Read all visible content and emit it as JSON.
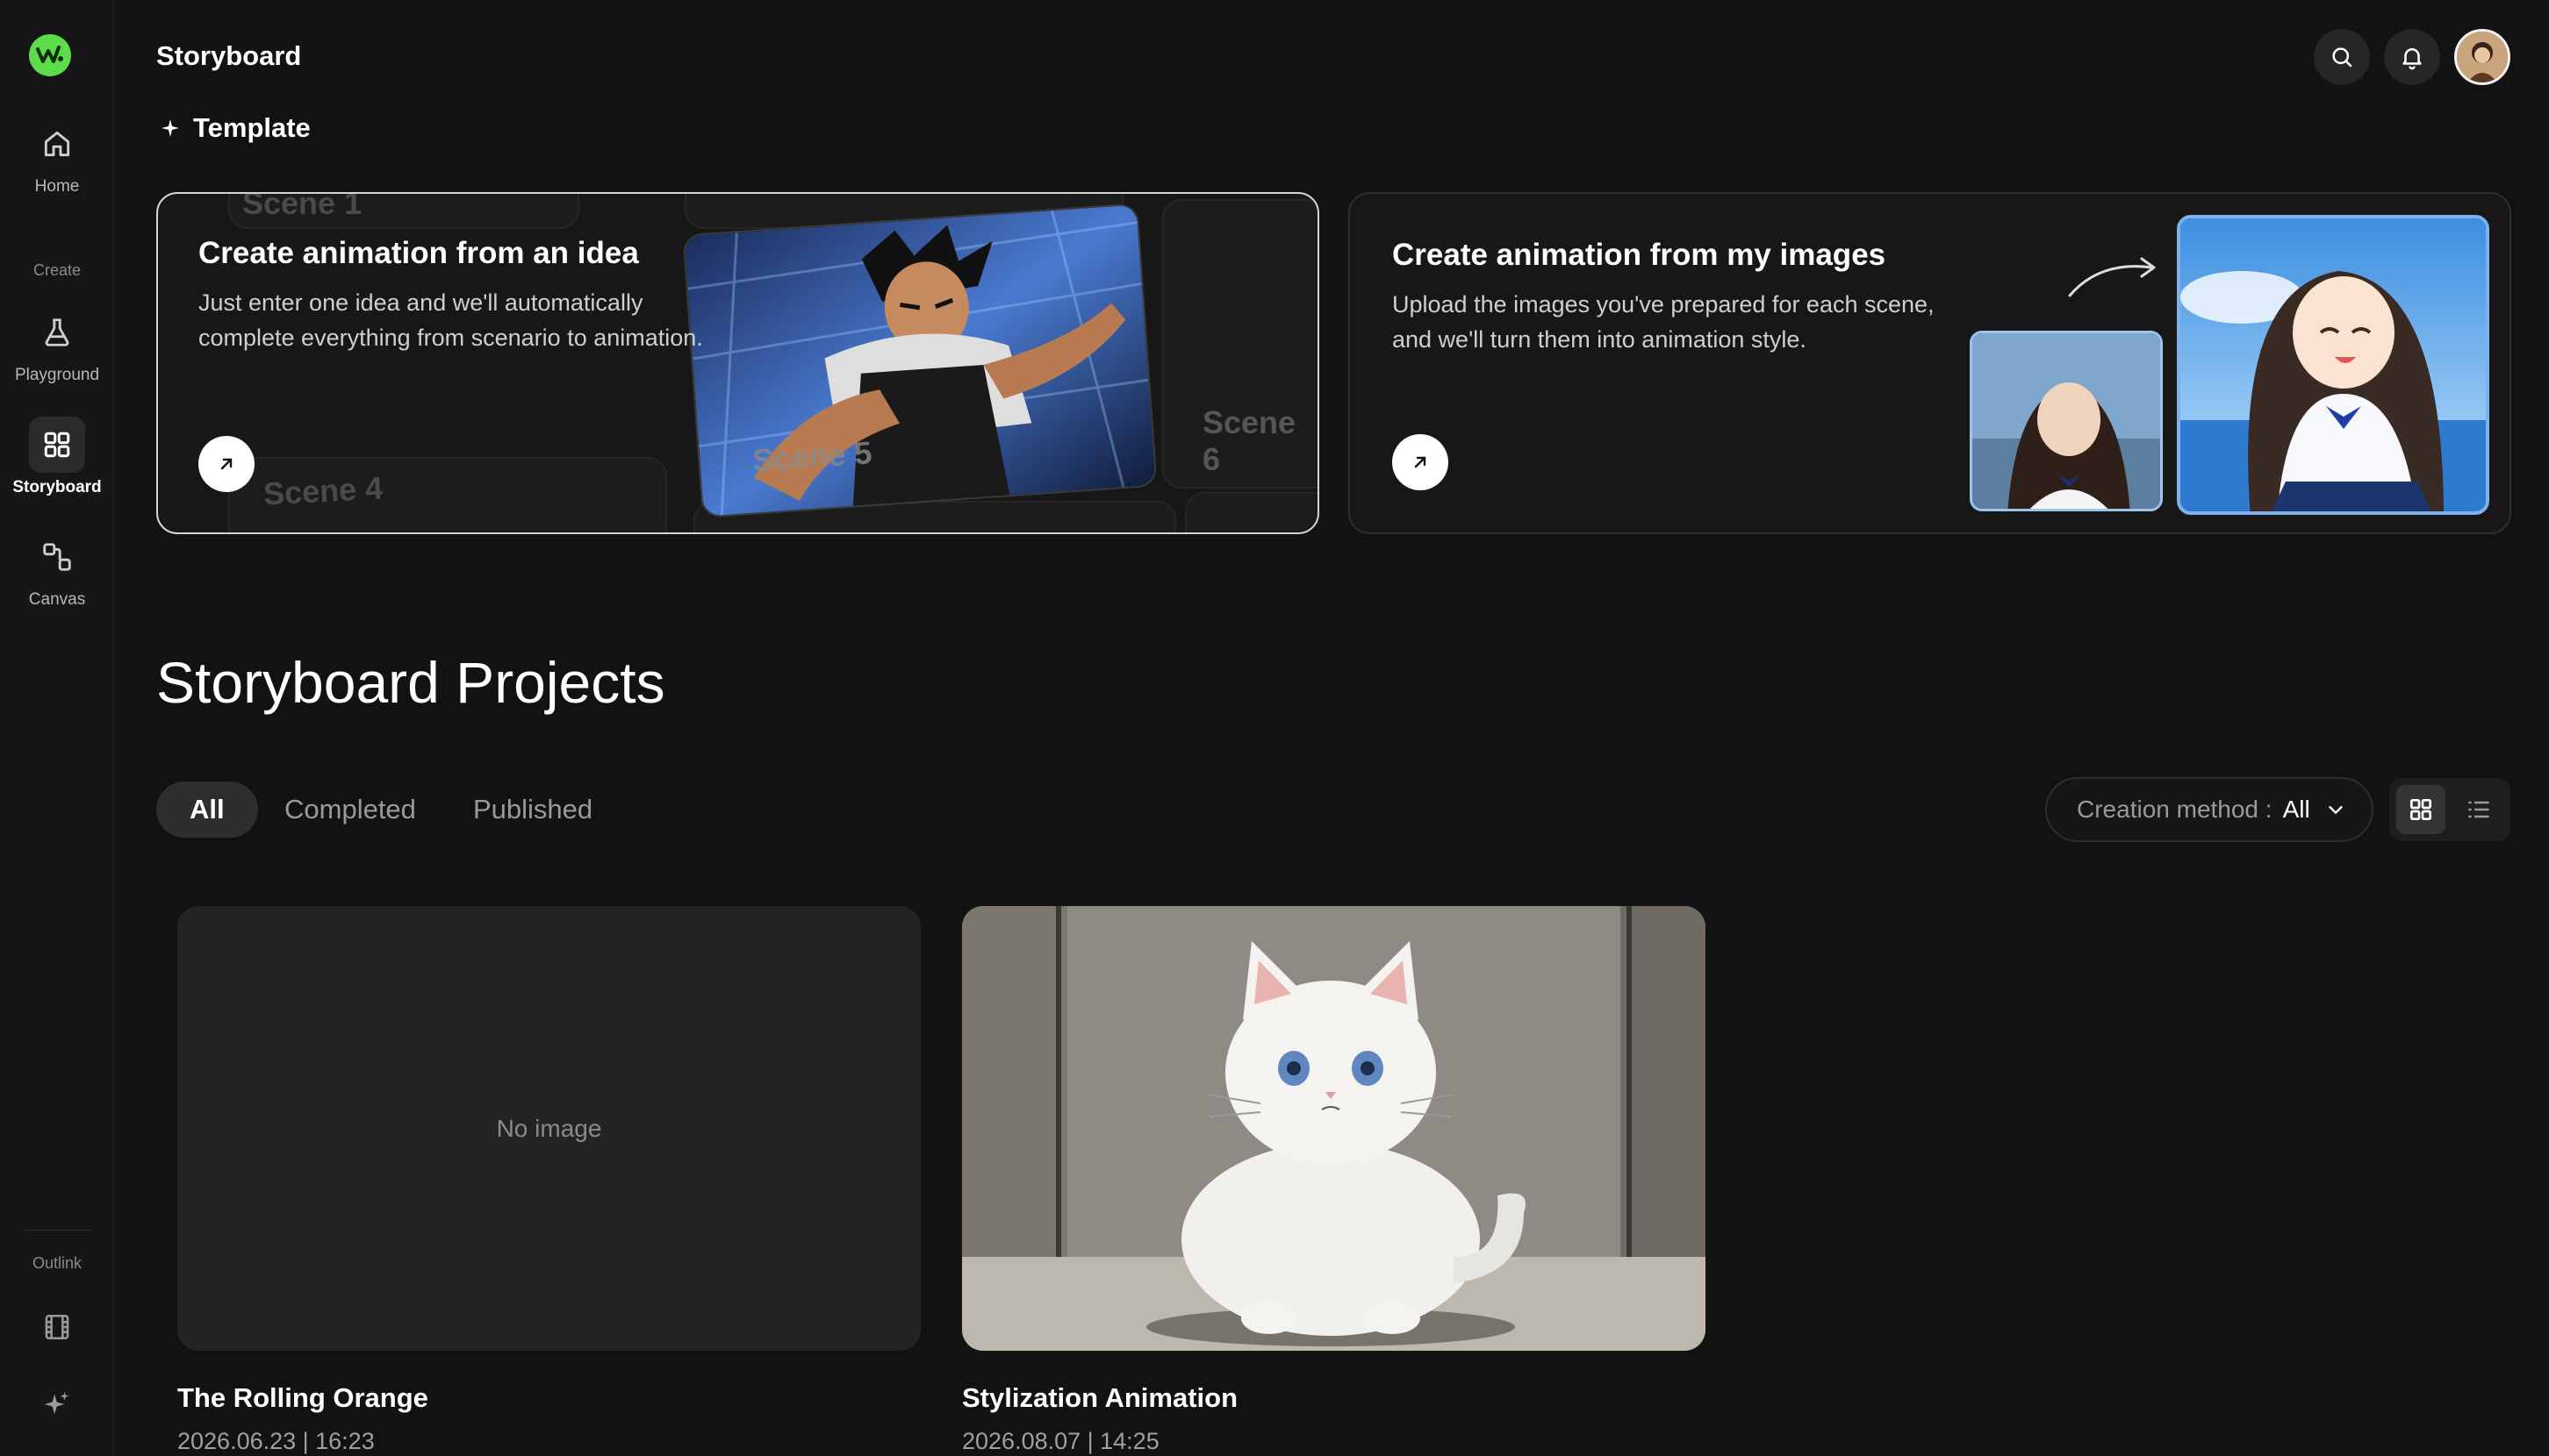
{
  "app": {
    "title": "Storyboard"
  },
  "sidebar": {
    "items": [
      {
        "label": "Home",
        "icon": "home-icon"
      },
      {
        "label": "Playground",
        "icon": "flask-icon"
      },
      {
        "label": "Storyboard",
        "icon": "grid-icon",
        "active": true
      },
      {
        "label": "Canvas",
        "icon": "nodes-icon"
      }
    ],
    "sections": {
      "create": "Create",
      "outlink": "Outlink"
    },
    "outlink_icons": [
      "film-icon",
      "sparkle-icon"
    ]
  },
  "template": {
    "label": "Template",
    "cards": [
      {
        "title": "Create animation from an idea",
        "description": "Just enter one idea and we'll automatically complete everything from scenario to animation.",
        "scenes": [
          "Scene 1",
          "Scene 4",
          "Scene 5",
          "Scene 6"
        ]
      },
      {
        "title": "Create animation from my images",
        "description": "Upload the images you've prepared for each scene, and we'll turn them into animation style."
      }
    ]
  },
  "projects": {
    "title": "Storyboard Projects",
    "tabs": [
      {
        "label": "All",
        "active": true
      },
      {
        "label": "Completed"
      },
      {
        "label": "Published"
      }
    ],
    "filter": {
      "label": "Creation method :",
      "value": "All"
    },
    "items": [
      {
        "name": "The Rolling Orange",
        "date": "2026.06.23 | 16:23",
        "thumbnail": "No image"
      },
      {
        "name": "Stylization Animation",
        "date": "2026.08.07 | 14:25"
      }
    ]
  },
  "colors": {
    "background": "#121212",
    "brand": "#5ddc4a",
    "card_border_active": "#d6d6d6"
  }
}
